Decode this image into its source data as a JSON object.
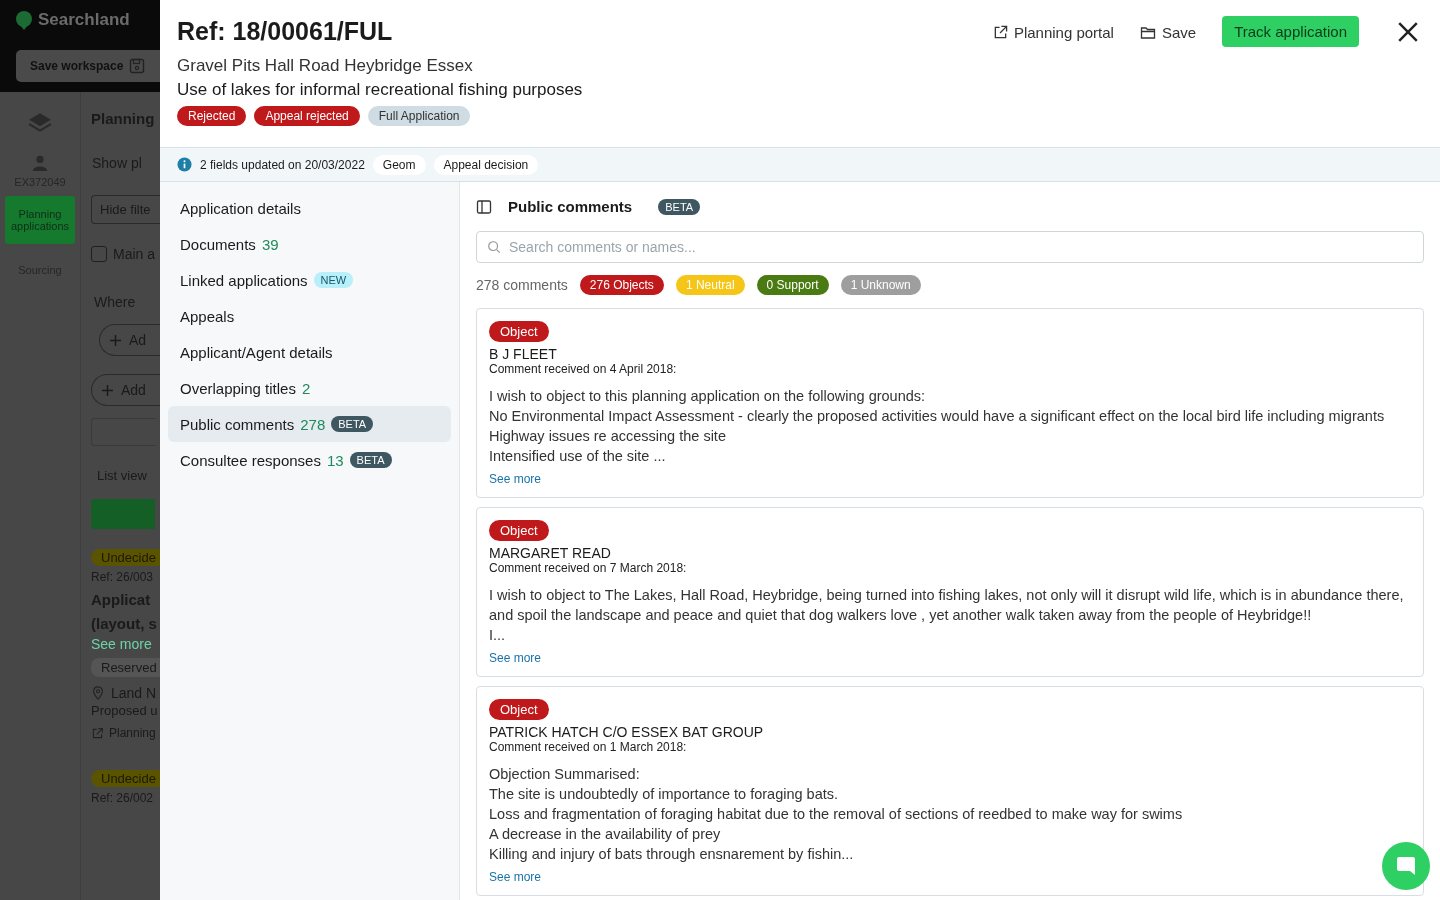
{
  "background": {
    "logo": "Searchland",
    "save_workspace": "Save workspace",
    "user": "EX372049",
    "rail": [
      {
        "label": "Planning applications",
        "selected": true
      },
      {
        "label": "Sourcing",
        "selected": false
      }
    ],
    "heading": "Planning",
    "show": "Show pl",
    "hide": "Hide filte",
    "main": "Main a",
    "main_checked": false,
    "where": "Where",
    "add1": "Ad",
    "add2": "Add",
    "list_view": "List view",
    "results": [
      {
        "status": "Undecide",
        "ref": "Ref: 26/003",
        "title": [
          "Applicat",
          "(layout, s"
        ],
        "see_more": "See more",
        "tag": "Reserved",
        "place": "Land N",
        "desc": "Proposed u",
        "link": "Planning"
      },
      {
        "status": "Undecide",
        "ref": "Ref: 26/002"
      }
    ]
  },
  "modal": {
    "ref": "Ref: 18/00061/FUL",
    "address": "Gravel Pits Hall Road Heybridge Essex",
    "description": "Use of lakes for informal recreational fishing purposes",
    "tags": [
      {
        "label": "Rejected",
        "kind": "red"
      },
      {
        "label": "Appeal rejected",
        "kind": "red"
      },
      {
        "label": "Full Application",
        "kind": "grey"
      }
    ],
    "actions": {
      "portal": "Planning portal",
      "save": "Save",
      "track": "Track application"
    },
    "updates": {
      "text": "2 fields updated on 20/03/2022",
      "fields": [
        "Geom",
        "Appeal decision"
      ]
    },
    "nav": [
      {
        "label": "Application details",
        "selected": false
      },
      {
        "label": "Documents",
        "count": "39",
        "selected": false
      },
      {
        "label": "Linked applications",
        "badge": {
          "label": "NEW",
          "kind": "new"
        },
        "selected": false
      },
      {
        "label": "Appeals",
        "selected": false
      },
      {
        "label": "Applicant/Agent details",
        "selected": false
      },
      {
        "label": "Overlapping titles",
        "count": "2",
        "selected": false
      },
      {
        "label": "Public comments",
        "count": "278",
        "badge": {
          "label": "BETA",
          "kind": "beta"
        },
        "selected": true
      },
      {
        "label": "Consultee responses",
        "count": "13",
        "badge": {
          "label": "BETA",
          "kind": "beta"
        },
        "selected": false
      }
    ],
    "panel": {
      "title": "Public comments",
      "badge": "BETA",
      "search": {
        "placeholder": "Search comments or names..."
      },
      "total": "278 comments",
      "counts": [
        {
          "label": "276 Objects",
          "color": "#c0191c"
        },
        {
          "label": "1 Neutral",
          "color": "#f5c518"
        },
        {
          "label": "0 Support",
          "color": "#4a7a12"
        },
        {
          "label": "1 Unknown",
          "color": "#9e9e9e"
        }
      ],
      "comments": [
        {
          "stance": "Object",
          "name": "B J FLEET",
          "received": "Comment received on 4 April 2018:",
          "lines": [
            "I wish to object to this planning application on the following grounds:",
            "No Environmental Impact Assessment - clearly the proposed activities would have a significant effect on the local bird life including migrants",
            "Highway issues re accessing the site",
            "Intensified use of the site ..."
          ],
          "see_more": "See more"
        },
        {
          "stance": "Object",
          "name": "MARGARET READ",
          "received": "Comment received on 7 March 2018:",
          "lines": [
            "I wish to object to The Lakes, Hall Road, Heybridge, being turned into fishing lakes, not only will it disrupt wild life, which is in abundance there, and spoil the landscape and peace and quiet that dog walkers love , yet another walk taken away from the people of Heybridge!!",
            "I..."
          ],
          "see_more": "See more"
        },
        {
          "stance": "Object",
          "name": "PATRICK HATCH C/O ESSEX BAT GROUP",
          "received": "Comment received on 1 March 2018:",
          "lines": [
            "Objection Summarised:",
            "The site is undoubtedly of importance to foraging bats.",
            "Loss and fragmentation of foraging habitat due to the removal of sections of reedbed to make way for swims",
            "A decrease in the availability of prey",
            "Killing and injury of bats through ensnarement by fishin..."
          ],
          "see_more": "See more"
        }
      ]
    }
  }
}
